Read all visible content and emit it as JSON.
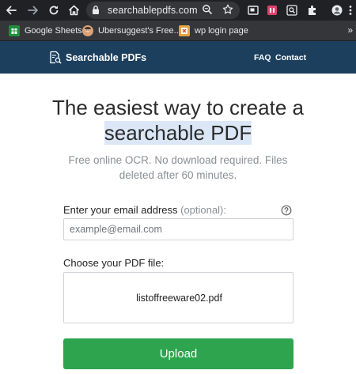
{
  "browser": {
    "url": "searchablepdfs.com",
    "bookmarks": [
      {
        "label": "Google Sheets",
        "icon": "google-sheets-icon",
        "color": "#1e8e3e"
      },
      {
        "label": "Ubersuggest's Free...",
        "icon": "ubersuggest-avatar-icon",
        "color": "#d9a27a"
      },
      {
        "label": "wp login page",
        "icon": "wp-login-icon",
        "color": "#e8a444"
      }
    ],
    "more": "»"
  },
  "site": {
    "brand": "Searchable PDFs",
    "nav": [
      {
        "label": "FAQ"
      },
      {
        "label": "Contact"
      }
    ],
    "header_color": "#1d3f5e"
  },
  "main": {
    "title_line1": "The easiest way to create a",
    "title_line2": "searchable PDF",
    "subtitle": "Free online OCR. No download required. Files deleted after 60 minutes.",
    "email_label": "Enter your email address ",
    "email_optional": "(optional):",
    "email_placeholder": "example@email.com",
    "file_label": "Choose your PDF file:",
    "file_name": "listoffreeware02.pdf",
    "upload_label": "Upload",
    "upload_color": "#2ea44f"
  }
}
